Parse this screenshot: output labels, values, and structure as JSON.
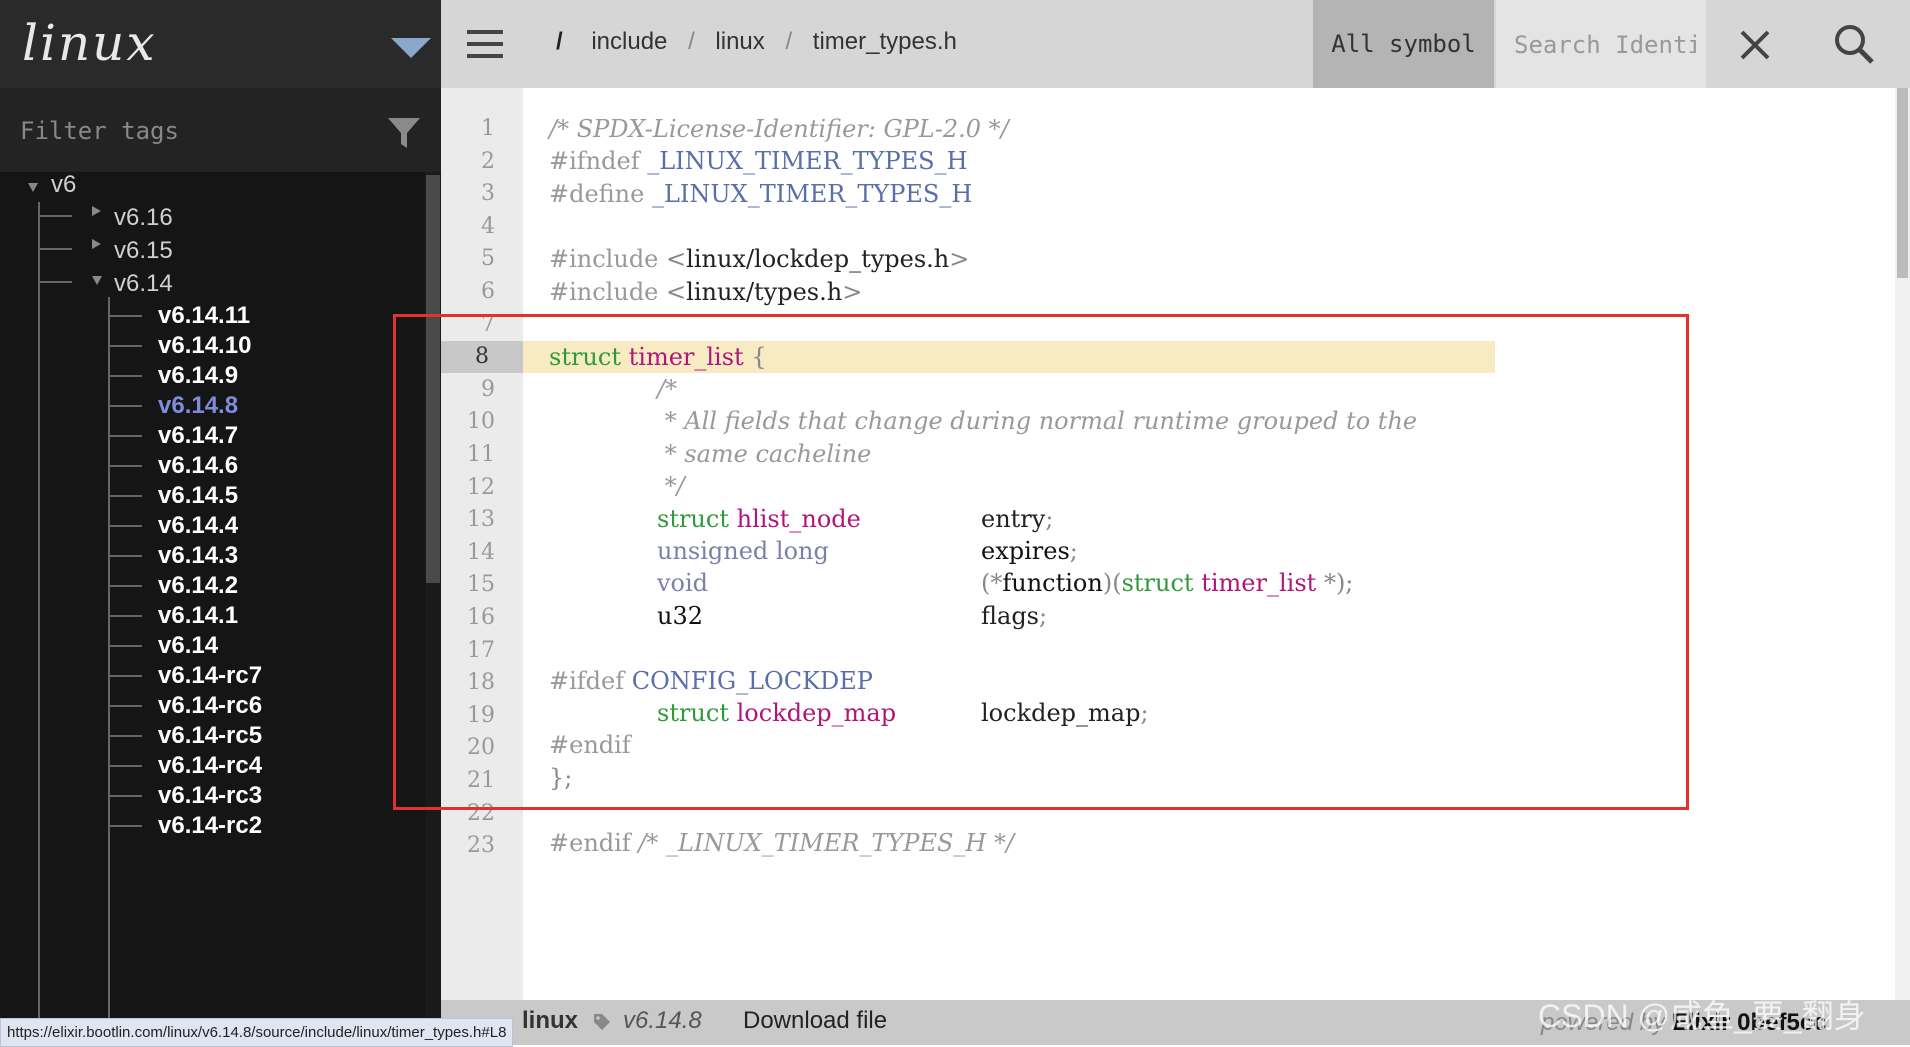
{
  "sidebar": {
    "project": "linux",
    "filter_placeholder": "Filter tags",
    "tree": {
      "root": "v6",
      "v6_16": "v6.16",
      "v6_15": "v6.15",
      "v6_14": "v6.14",
      "leaves": [
        "v6.14.11",
        "v6.14.10",
        "v6.14.9",
        "v6.14.8",
        "v6.14.7",
        "v6.14.6",
        "v6.14.5",
        "v6.14.4",
        "v6.14.3",
        "v6.14.2",
        "v6.14.1",
        "v6.14",
        "v6.14-rc7",
        "v6.14-rc6",
        "v6.14-rc5",
        "v6.14-rc4",
        "v6.14-rc3",
        "v6.14-rc2"
      ],
      "active_leaf": "v6.14.8"
    }
  },
  "header": {
    "breadcrumb_root": "/",
    "breadcrumb": [
      "include",
      "linux",
      "timer_types.h"
    ],
    "breadcrumb_sep": "/",
    "symbol_select": "All symbol",
    "search_placeholder": "Search Identifier"
  },
  "code": {
    "highlight_line": 8,
    "line_numbers": [
      "1",
      "2",
      "3",
      "4",
      "5",
      "6",
      "7",
      "8",
      "9",
      "10",
      "11",
      "12",
      "13",
      "14",
      "15",
      "16",
      "17",
      "18",
      "19",
      "20",
      "21",
      "22",
      "23"
    ],
    "l1": "/* SPDX-License-Identifier: GPL-2.0 */",
    "l2_a": "#ifndef",
    "l2_b": "_LINUX_TIMER_TYPES_H",
    "l3_a": "#define",
    "l3_b": "_LINUX_TIMER_TYPES_H",
    "l5_a": "#include",
    "l5_b": "<",
    "l5_c": "linux/lockdep_types.h",
    "l5_d": ">",
    "l6_a": "#include",
    "l6_b": "<",
    "l6_c": "linux/types.h",
    "l6_d": ">",
    "l8_a": "struct",
    "l8_b": "timer_list",
    "l8_c": "{",
    "l9": "/*",
    "l10": " * All fields that change during normal runtime grouped to the",
    "l11": " * same cacheline",
    "l12": " */",
    "l13_a": "struct",
    "l13_b": "hlist_node",
    "l13_c": "entry",
    "l13_d": ";",
    "l14_a": "unsigned long",
    "l14_b": "expires",
    "l14_c": ";",
    "l15_a": "void",
    "l15_b": "(*",
    "l15_c": "function",
    "l15_d": ")",
    "l15_e": "(",
    "l15_f": "struct",
    "l15_g": "timer_list",
    "l15_h": "*);",
    "l16_a": "u32",
    "l16_b": "flags",
    "l16_c": ";",
    "l18_a": "#ifdef",
    "l18_b": "CONFIG_LOCKDEP",
    "l19_a": "struct",
    "l19_b": "lockdep_map",
    "l19_c": "lockdep_map",
    "l19_d": ";",
    "l20": "#endif",
    "l21": "};",
    "l23_a": "#endif",
    "l23_b": "/* _LINUX_TIMER_TYPES_H */"
  },
  "footer": {
    "project": "linux",
    "version": "v6.14.8",
    "download": "Download file",
    "powered_prefix": "powered by",
    "powered_name": "Elixir 0bef5cc",
    "watermark": "CSDN @咸鱼_要_翻身",
    "status_url": "https://elixir.bootlin.com/linux/v6.14.8/source/include/linux/timer_types.h#L8"
  },
  "colors": {
    "highlight": "#f7ebc3",
    "annotation_box": "#e53030",
    "active_tag": "#7e8cdb"
  }
}
